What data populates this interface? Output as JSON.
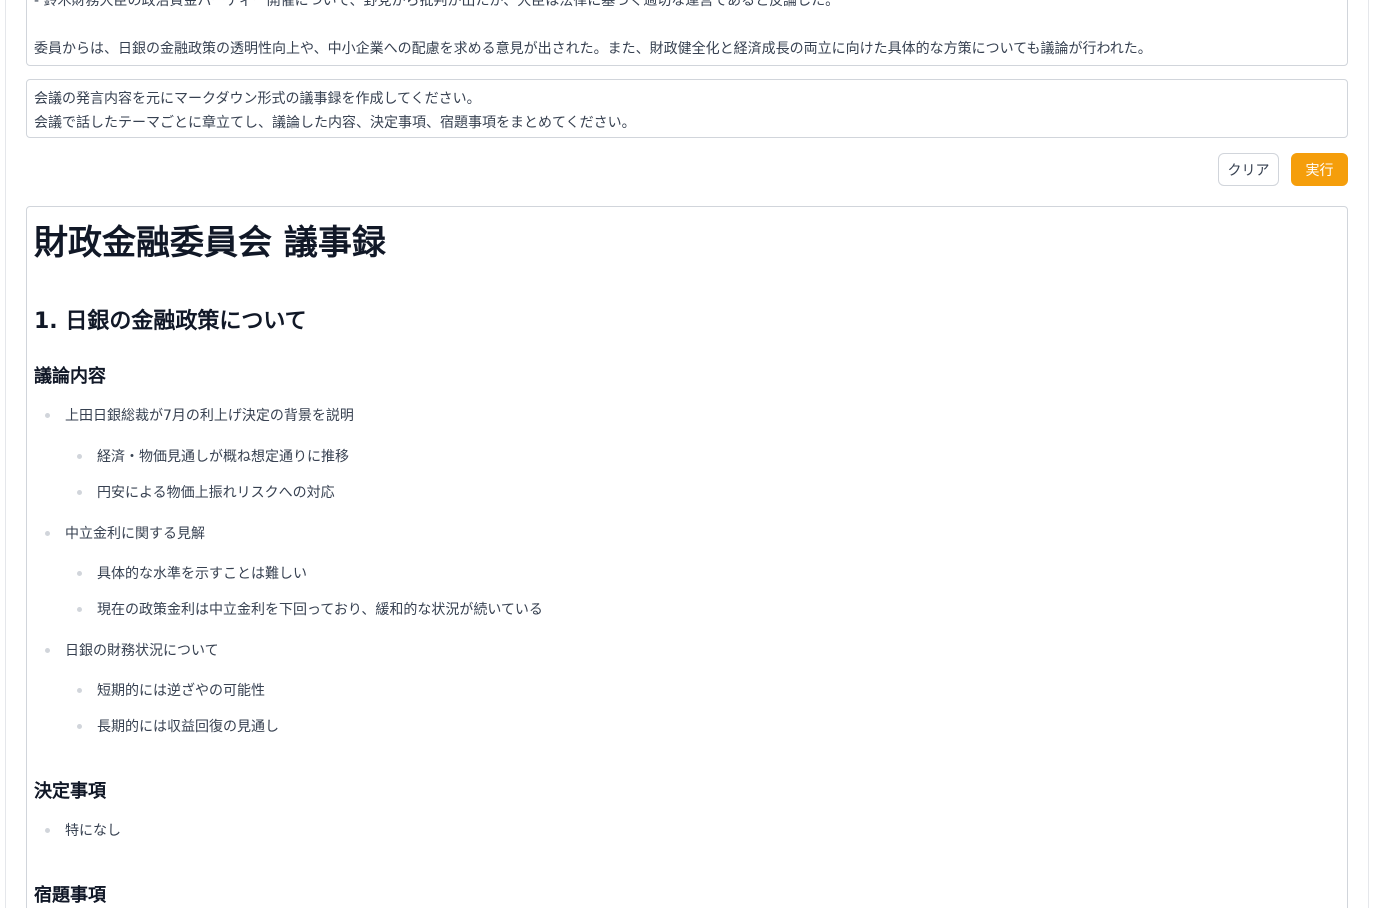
{
  "source_text": {
    "line1": "- 鈴木財務大臣の政治資金パーティー開催について、野党から批判が出たが、大臣は法律に基づく適切な運営であると反論した。",
    "line2": "委員からは、日銀の金融政策の透明性向上や、中小企業への配慮を求める意見が出された。また、財政健全化と経済成長の両立に向けた具体的な方策についても議論が行われた。"
  },
  "prompt": {
    "line1": "会議の発言内容を元にマークダウン形式の議事録を作成してください。",
    "line2": "会議で話したテーマごとに章立てし、議論した内容、決定事項、宿題事項をまとめてください。"
  },
  "buttons": {
    "clear": "クリア",
    "run": "実行"
  },
  "colors": {
    "accent": "#f59e0b"
  },
  "output": {
    "title": "財政金融委員会 議事録",
    "section1": {
      "heading": "1. 日銀の金融政策について",
      "discussion_heading": "議論内容",
      "items": [
        {
          "text": "上田日銀総裁が7月の利上げ決定の背景を説明",
          "sub": [
            "経済・物価見通しが概ね想定通りに推移",
            "円安による物価上振れリスクへの対応"
          ]
        },
        {
          "text": "中立金利に関する見解",
          "sub": [
            "具体的な水準を示すことは難しい",
            "現在の政策金利は中立金利を下回っており、緩和的な状況が続いている"
          ]
        },
        {
          "text": "日銀の財務状況について",
          "sub": [
            "短期的には逆ざやの可能性",
            "長期的には収益回復の見通し"
          ]
        }
      ],
      "decisions_heading": "決定事項",
      "decisions": [
        "特になし"
      ],
      "todos_heading": "宿題事項"
    }
  }
}
